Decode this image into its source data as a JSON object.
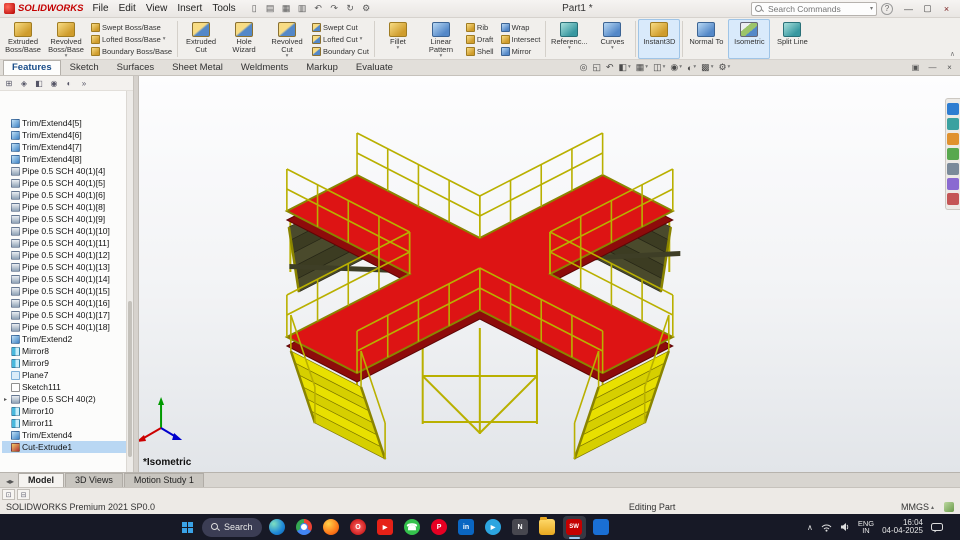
{
  "colors": {
    "deck_red": "#dd1414",
    "structure_yellow": "#cfc600",
    "selection_blue": "#b9d7f3",
    "accent_blue": "#d9eafb"
  },
  "titlebar": {
    "logo_text": "SOLIDWORKS",
    "menus": [
      "File",
      "Edit",
      "View",
      "Insert",
      "Tools"
    ],
    "quick_icons": [
      "new",
      "open",
      "save",
      "print",
      "undo",
      "redo",
      "rebuild",
      "options"
    ],
    "doc_title": "Part1 *",
    "search_placeholder": "Search Commands",
    "help_label": "?",
    "window_buttons": [
      "minimize",
      "maximize",
      "close"
    ]
  },
  "ribbon": {
    "tabs": [
      {
        "label": "Features",
        "active": true
      },
      {
        "label": "Sketch"
      },
      {
        "label": "Surfaces"
      },
      {
        "label": "Sheet Metal"
      },
      {
        "label": "Weldments"
      },
      {
        "label": "Markup"
      },
      {
        "label": "Evaluate"
      }
    ],
    "columns": [
      {
        "type": "big",
        "label": "Extruded Boss/Base",
        "icon": "extruded-boss"
      },
      {
        "type": "big",
        "label": "Revolved Boss/Base",
        "icon": "revolved-boss",
        "caret": true
      },
      {
        "type": "stack",
        "items": [
          {
            "label": "Swept Boss/Base",
            "icon": "swept-boss"
          },
          {
            "label": "Lofted Boss/Base",
            "icon": "lofted-boss",
            "caret": true
          },
          {
            "label": "Boundary Boss/Base",
            "icon": "boundary-boss"
          }
        ]
      },
      {
        "type": "sep"
      },
      {
        "type": "big",
        "label": "Extruded Cut",
        "icon": "extruded-cut"
      },
      {
        "type": "big",
        "label": "Hole Wizard",
        "icon": "hole-wizard"
      },
      {
        "type": "big",
        "label": "Revolved Cut",
        "icon": "revolved-cut",
        "caret": true
      },
      {
        "type": "stack",
        "items": [
          {
            "label": "Swept Cut",
            "icon": "swept-cut"
          },
          {
            "label": "Lofted Cut",
            "icon": "lofted-cut",
            "caret": true
          },
          {
            "label": "Boundary Cut",
            "icon": "boundary-cut"
          }
        ]
      },
      {
        "type": "sep"
      },
      {
        "type": "big",
        "label": "Fillet",
        "icon": "fillet",
        "caret": true
      },
      {
        "type": "big",
        "label": "Linear Pattern",
        "icon": "linear-pattern",
        "caret": true
      },
      {
        "type": "stack",
        "items": [
          {
            "label": "Rib",
            "icon": "rib"
          },
          {
            "label": "Draft",
            "icon": "draft"
          },
          {
            "label": "Shell",
            "icon": "shell"
          }
        ]
      },
      {
        "type": "stack",
        "items": [
          {
            "label": "Wrap",
            "icon": "wrap"
          },
          {
            "label": "Intersect",
            "icon": "intersect"
          },
          {
            "label": "Mirror",
            "icon": "mirror"
          }
        ]
      },
      {
        "type": "sep"
      },
      {
        "type": "big",
        "label": "Referenc...",
        "icon": "reference-geometry",
        "caret": true
      },
      {
        "type": "big",
        "label": "Curves",
        "icon": "curves",
        "caret": true
      },
      {
        "type": "sep"
      },
      {
        "type": "big",
        "label": "Instant3D",
        "icon": "instant3d",
        "active": true
      },
      {
        "type": "sep"
      },
      {
        "type": "big",
        "label": "Normal To",
        "icon": "normal-to"
      },
      {
        "type": "big",
        "label": "Isometric",
        "icon": "isometric",
        "active": true
      },
      {
        "type": "big",
        "label": "Split Line",
        "icon": "split-line"
      }
    ]
  },
  "headsup_icons": [
    "zoom-fit",
    "zoom-to-area",
    "previous-view",
    "section-view",
    "view-orientation",
    "display-style",
    "hide-show-items",
    "edit-appearance",
    "apply-scene",
    "view-settings"
  ],
  "pane_controls": [
    "tile-windows",
    "minimize-window",
    "close-window"
  ],
  "tree": {
    "toolbar": [
      "featuremanager-tab",
      "propertymanager-tab",
      "configurationmanager-tab",
      "dimxpert-tab",
      "displaymanager-tab",
      "overflow"
    ],
    "items": [
      {
        "label": "Trim/Extend4[5]",
        "icon": "trim"
      },
      {
        "label": "Trim/Extend4[6]",
        "icon": "trim"
      },
      {
        "label": "Trim/Extend4[7]",
        "icon": "trim"
      },
      {
        "label": "Trim/Extend4[8]",
        "icon": "trim"
      },
      {
        "label": "Pipe 0.5 SCH 40(1)[4]",
        "icon": "pipe"
      },
      {
        "label": "Pipe 0.5 SCH 40(1)[5]",
        "icon": "pipe"
      },
      {
        "label": "Pipe 0.5 SCH 40(1)[6]",
        "icon": "pipe"
      },
      {
        "label": "Pipe 0.5 SCH 40(1)[8]",
        "icon": "pipe"
      },
      {
        "label": "Pipe 0.5 SCH 40(1)[9]",
        "icon": "pipe"
      },
      {
        "label": "Pipe 0.5 SCH 40(1)[10]",
        "icon": "pipe"
      },
      {
        "label": "Pipe 0.5 SCH 40(1)[11]",
        "icon": "pipe"
      },
      {
        "label": "Pipe 0.5 SCH 40(1)[12]",
        "icon": "pipe"
      },
      {
        "label": "Pipe 0.5 SCH 40(1)[13]",
        "icon": "pipe"
      },
      {
        "label": "Pipe 0.5 SCH 40(1)[14]",
        "icon": "pipe"
      },
      {
        "label": "Pipe 0.5 SCH 40(1)[15]",
        "icon": "pipe"
      },
      {
        "label": "Pipe 0.5 SCH 40(1)[16]",
        "icon": "pipe"
      },
      {
        "label": "Pipe 0.5 SCH 40(1)[17]",
        "icon": "pipe"
      },
      {
        "label": "Pipe 0.5 SCH 40(1)[18]",
        "icon": "pipe"
      },
      {
        "label": "Trim/Extend2",
        "icon": "trim"
      },
      {
        "label": "Mirror8",
        "icon": "mirror"
      },
      {
        "label": "Mirror9",
        "icon": "mirror"
      },
      {
        "label": "Plane7",
        "icon": "plane"
      },
      {
        "label": "Sketch111",
        "icon": "sketch"
      },
      {
        "label": "Pipe 0.5 SCH 40(2)",
        "icon": "pipe",
        "expand": true
      },
      {
        "label": "Mirror10",
        "icon": "mirror"
      },
      {
        "label": "Mirror11",
        "icon": "mirror"
      },
      {
        "label": "Trim/Extend4",
        "icon": "trim"
      },
      {
        "label": "Cut-Extrude1",
        "icon": "cut",
        "selected": true
      }
    ]
  },
  "viewport": {
    "view_label": "*Isometric"
  },
  "bottom_tabs": [
    {
      "label": "Model",
      "active": true
    },
    {
      "label": "3D Views"
    },
    {
      "label": "Motion Study 1"
    }
  ],
  "statusbar": {
    "product": "SOLIDWORKS Premium 2021 SP0.0",
    "mode": "Editing Part",
    "units": "MMGS"
  },
  "taskbar": {
    "search_label": "Search",
    "apps": [
      {
        "name": "edge",
        "glyph": ""
      },
      {
        "name": "chrome",
        "glyph": ""
      },
      {
        "name": "firefox",
        "glyph": ""
      },
      {
        "name": "opera",
        "glyph": "O"
      },
      {
        "name": "youtube",
        "glyph": "▶"
      },
      {
        "name": "whatsapp",
        "glyph": "☎"
      },
      {
        "name": "pinterest",
        "glyph": "P"
      },
      {
        "name": "linkedin",
        "glyph": "in"
      },
      {
        "name": "telegram",
        "glyph": "▶"
      },
      {
        "name": "notepad",
        "glyph": "N"
      },
      {
        "name": "file-explorer",
        "glyph": ""
      },
      {
        "name": "solidworks",
        "glyph": "SW",
        "active": true
      },
      {
        "name": "photoshop",
        "glyph": ""
      }
    ],
    "tray": {
      "lang_line1": "ENG",
      "lang_line2": "IN",
      "time": "16:04",
      "date": "04-04-2025"
    }
  }
}
